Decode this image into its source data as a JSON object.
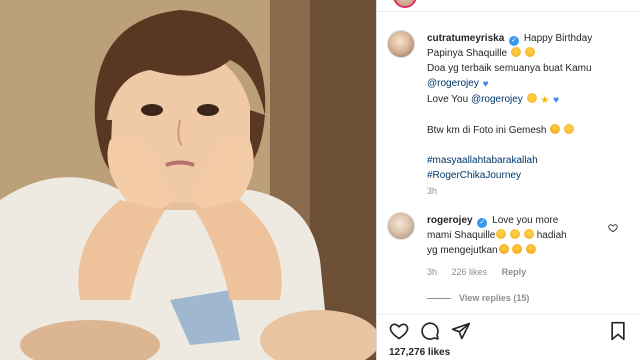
{
  "post": {
    "image_alt": "Child resting chin on hands",
    "caption": {
      "username": "cutratumeyriska",
      "line1": "Happy Birthday",
      "line2": "Papinya Shaquille",
      "line3": "Doa yg terbaik semuanya buat Kamu",
      "mention1": "@rogerojey",
      "line5_prefix": "Love You",
      "mention2": "@rogerojey",
      "line7": "Btw km di Foto ini Gemesh",
      "hashtag1": "#masyaallahtabarakallah",
      "hashtag2": "#RogerChikaJourney",
      "time": "3h"
    },
    "comment": {
      "username": "rogerojey",
      "text1": "Love you more",
      "text2": "mami Shaquille",
      "text3": "hadiah",
      "text4": "yg mengejutkan",
      "time": "3h",
      "likes": "226 likes",
      "reply": "Reply"
    },
    "view_replies": "View replies (15)",
    "likes_total": "127,276 likes",
    "icons": {
      "like": "heart-icon",
      "comment": "comment-icon",
      "share": "paper-plane-icon",
      "save": "bookmark-icon"
    },
    "colors": {
      "link": "#00376b",
      "verified": "#3897f0",
      "muted": "#8e8e8e"
    }
  }
}
